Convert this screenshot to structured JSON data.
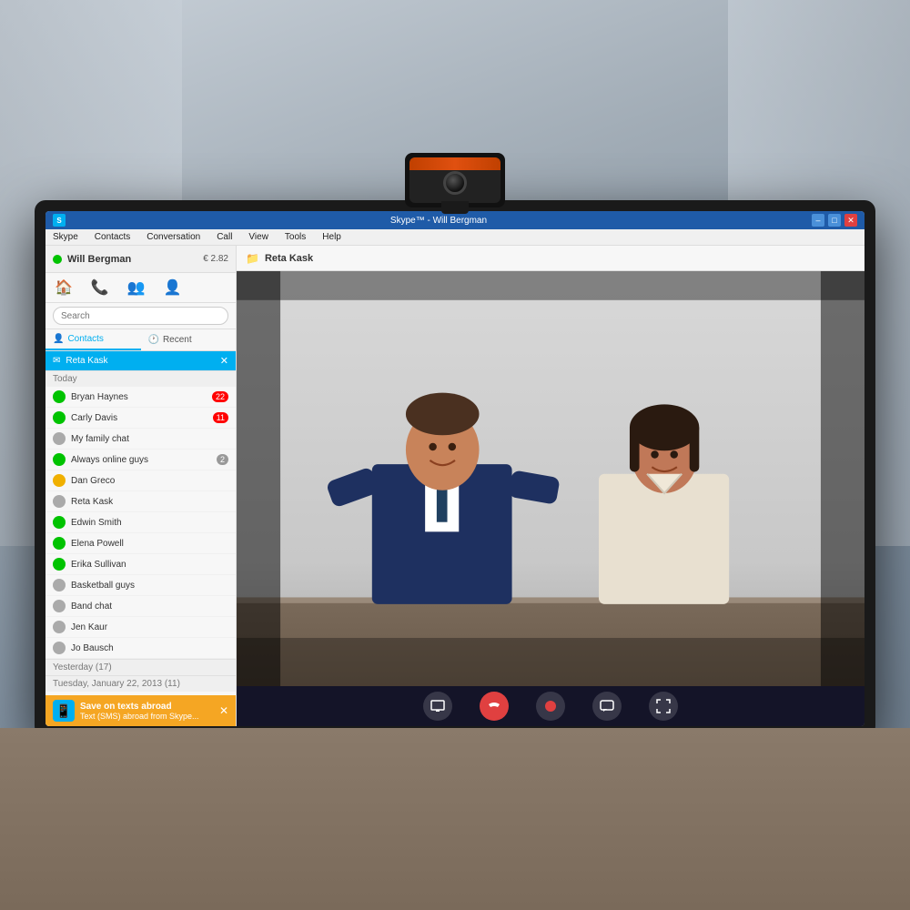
{
  "app": {
    "title": "Skype™ - Will Bergman",
    "icon": "S"
  },
  "titleBar": {
    "title": "Skype™ - Will Bergman",
    "minimizeLabel": "–",
    "maximizeLabel": "□",
    "closeLabel": "✕"
  },
  "menuBar": {
    "items": [
      "Skype",
      "Contacts",
      "Conversation",
      "Call",
      "View",
      "Tools",
      "Help"
    ]
  },
  "sidebar": {
    "user": {
      "name": "Will Bergman",
      "credit": "€ 2.82"
    },
    "navIcons": [
      "🏠",
      "📞",
      "👥",
      "👤+"
    ],
    "searchPlaceholder": "Search",
    "tabs": [
      {
        "label": "Contacts",
        "icon": "👤",
        "active": true
      },
      {
        "label": "Recent",
        "icon": "🕐",
        "active": false
      }
    ],
    "selectedContact": "Reta Kask",
    "sections": [
      {
        "title": "Today",
        "contacts": [
          {
            "name": "Bryan Haynes",
            "status": "green",
            "badge": "22"
          },
          {
            "name": "Carly Davis",
            "status": "green",
            "badge": "11"
          },
          {
            "name": "My family chat",
            "status": "group",
            "badge": ""
          },
          {
            "name": "Always online guys",
            "status": "group",
            "badge": "2"
          },
          {
            "name": "Dan Greco",
            "status": "yellow",
            "badge": ""
          },
          {
            "name": "Reta Kask",
            "status": "gray",
            "badge": ""
          },
          {
            "name": "Edwin Smith",
            "status": "green",
            "badge": ""
          },
          {
            "name": "Elena Powell",
            "status": "green",
            "badge": ""
          },
          {
            "name": "Erika Sullivan",
            "status": "green",
            "badge": ""
          },
          {
            "name": "Basketball guys",
            "status": "group",
            "badge": ""
          },
          {
            "name": "Band chat",
            "status": "group",
            "badge": ""
          },
          {
            "name": "Jen Kaur",
            "status": "gray",
            "badge": ""
          },
          {
            "name": "Jo Bausch",
            "status": "gray",
            "badge": ""
          }
        ]
      },
      {
        "title": "Yesterday (17)",
        "contacts": []
      },
      {
        "title": "Tuesday, January 22, 2013 (11)",
        "contacts": []
      }
    ],
    "notification": {
      "title": "Save on texts abroad",
      "subtitle": "Text (SMS) abroad from Skype..."
    }
  },
  "videoPanel": {
    "contactName": "Reta Kask",
    "controls": [
      "screen-share",
      "end-call",
      "record",
      "message",
      "expand"
    ]
  },
  "monitor": {
    "standVisible": true
  }
}
